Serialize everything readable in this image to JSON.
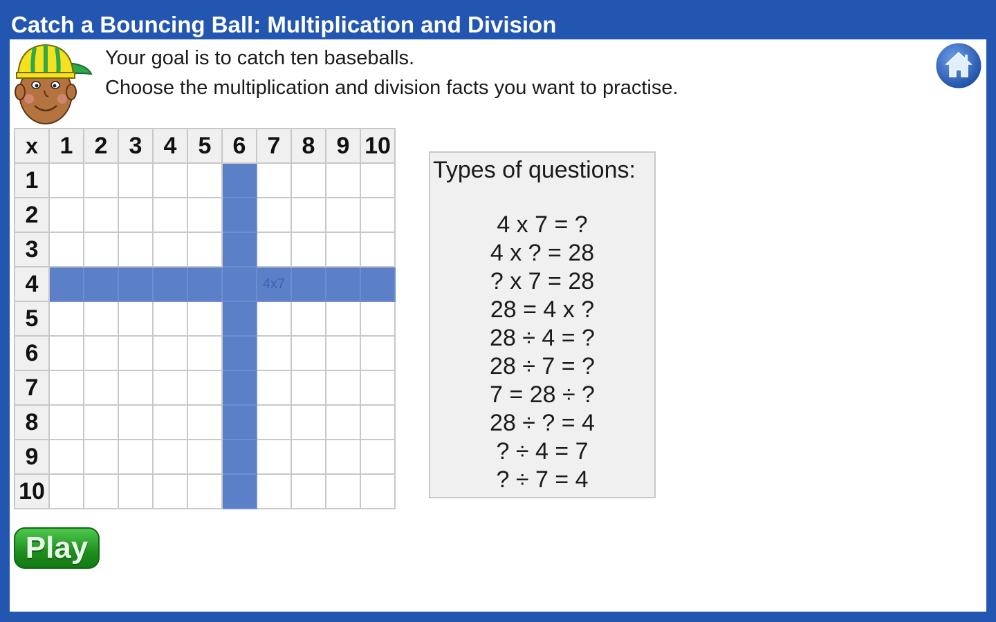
{
  "app": {
    "title": "Catch a Bouncing Ball: Multiplication and Division"
  },
  "instructions": {
    "line1": "Your goal is to catch ten baseballs.",
    "line2": "Choose the multiplication and division facts you want to practise."
  },
  "icons": {
    "home": "home-icon",
    "avatar": "boy-with-cap-avatar"
  },
  "colors": {
    "frame": "#2356b0",
    "selected_cell": "#5b80c8",
    "play_button": "#1e8e1e"
  },
  "grid": {
    "corner": "x",
    "columns": [
      "1",
      "2",
      "3",
      "4",
      "5",
      "6",
      "7",
      "8",
      "9",
      "10"
    ],
    "rows": [
      "1",
      "2",
      "3",
      "4",
      "5",
      "6",
      "7",
      "8",
      "9",
      "10"
    ],
    "selected_row": 4,
    "selected_column": 6,
    "target_cell_label": "4x7"
  },
  "question_types": {
    "title": "Types of questions:",
    "items": [
      "4 x 7 = ?",
      "4 x ? = 28",
      "? x 7 = 28",
      "28 = 4 x ?",
      "28 ÷ 4 = ?",
      "28 ÷ 7 = ?",
      "7 = 28 ÷ ?",
      "28 ÷ ? = 4",
      "? ÷ 4 = 7",
      "? ÷ 7 = 4"
    ]
  },
  "buttons": {
    "play": "Play"
  }
}
